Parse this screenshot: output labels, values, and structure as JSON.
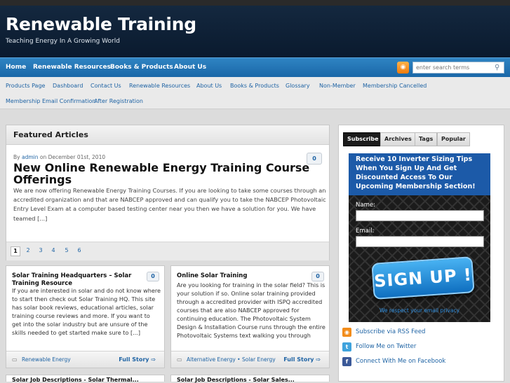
{
  "site": {
    "title": "Renewable Training",
    "tagline": "Teaching Energy In A Growing World"
  },
  "nav_primary": [
    "Home",
    "Renewable Resources",
    "Books & Products",
    "About Us"
  ],
  "search": {
    "placeholder": "enter search terms"
  },
  "nav_secondary": {
    "row1": [
      "Products Page",
      "Dashboard",
      "Contact Us",
      "Renewable Resources",
      "About Us",
      "Books & Products",
      "Glossary",
      "Non-Member",
      "Membership Cancelled"
    ],
    "row2": [
      "Membership Email Confirmation",
      "After Registration"
    ]
  },
  "featured": {
    "heading": "Featured Articles",
    "by": "By",
    "author": "admin",
    "date": "on December 01st, 2010",
    "comments": "0",
    "title": "New Online Renewable Energy Training Course Offerings",
    "excerpt": "We are now offering Renewable Energy Training Courses. If you are looking to take some courses through an accredited organization and that are NABCEP approved and can qualify you to take the NABCEP Photovoltaic Entry Level Exam at a computer based testing center near you then we have a solution for you. We have teamed [...]",
    "pages": [
      "1",
      "2",
      "3",
      "4",
      "5",
      "6"
    ]
  },
  "posts": [
    {
      "title": "Solar Training Headquarters – Solar Training Resource",
      "comments": "0",
      "excerpt": "If you are interested in solar and do not know where to start then check out Solar Training HQ. This site has solar book reviews, educational articles, solar training course reviews and more. If you want to get into the solar industry but are unsure of the skills needed to get started make sure to [...]",
      "category": "Renewable Energy",
      "more": "Full Story"
    },
    {
      "title": "Online Solar Training",
      "comments": "0",
      "excerpt": "Are you looking for training in the solar field? This is your solution if so. Online solar training provided through a accredited provider with ISPQ accredited courses that are also NABCEP approved for continuing education. The Photovoltaic System Design & Installation Course runs through the entire Photovoltaic Systems text walking you through",
      "category": "Alternative Energy • Solar Energy",
      "more": "Full Story"
    }
  ],
  "post_stubs": [
    "Solar Job Descriptions - Solar Thermal...",
    "Solar Job Descriptions - Solar Sales..."
  ],
  "sidebar": {
    "tabs": [
      "Subscribe",
      "Archives",
      "Tags",
      "Popular"
    ],
    "promo_heading": "Receive 10 Inverter Sizing Tips When You Sign Up And Get Discounted Access To Our Upcoming Membership Section!",
    "name_label": "Name:",
    "email_label": "Email:",
    "signup_label": "SIGN UP !",
    "privacy": "We respect your email privacy",
    "social": [
      {
        "label": "Subscribe via RSS Feed",
        "icon": "rss-icon",
        "color": "#f28c1a"
      },
      {
        "label": "Follow Me on Twitter",
        "icon": "twitter-icon",
        "color": "#3fa3dd"
      },
      {
        "label": "Connect With Me on Facebook",
        "icon": "facebook-icon",
        "color": "#3b5998"
      }
    ]
  },
  "colors": {
    "header_bg": "#0f2238",
    "nav_blue": "#2478b8",
    "link": "#1e63a4",
    "promo_blue": "#1c5aa8"
  }
}
